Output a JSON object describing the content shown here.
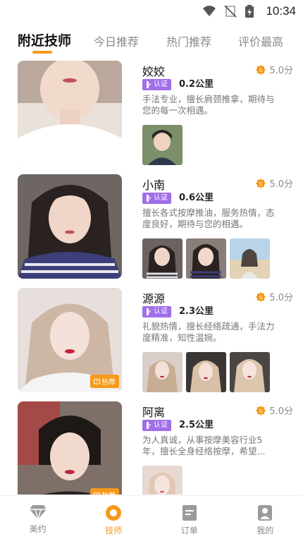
{
  "status_bar": {
    "time": "10:34"
  },
  "tabs": [
    {
      "label": "附近技师",
      "active": true
    },
    {
      "label": "今日推荐",
      "active": false
    },
    {
      "label": "热门推荐",
      "active": false
    },
    {
      "label": "评价最高",
      "active": false
    }
  ],
  "cert_label": "认证",
  "hot_label": "热荐",
  "technicians": [
    {
      "name": "姣姣",
      "rating": "5.0分",
      "distance": "0.2公里",
      "desc": "手法专业，擅长肩颈推拿，期待与您的每一次相遇。",
      "photo_count": 1,
      "hot": false
    },
    {
      "name": "小南",
      "rating": "5.0分",
      "distance": "0.6公里",
      "desc": "擅长各式按摩推油，服务热情，态度良好，期待与您的相遇。",
      "photo_count": 3,
      "hot": false
    },
    {
      "name": "源源",
      "rating": "5.0分",
      "distance": "2.3公里",
      "desc": "礼貌热情，擅长经络疏通，手法力度精准，知性温婉。",
      "photo_count": 3,
      "hot": true
    },
    {
      "name": "阿离",
      "rating": "5.0分",
      "distance": "2.5公里",
      "desc": "为人真诚，从事按摩美容行业5年，擅长全身经络按摩，希望...",
      "photo_count": 1,
      "hot": true
    }
  ],
  "bottom_nav": [
    {
      "label": "美约",
      "icon": "diamond-icon",
      "active": false
    },
    {
      "label": "技师",
      "icon": "circle-icon",
      "active": true
    },
    {
      "label": "订单",
      "icon": "document-icon",
      "active": false
    },
    {
      "label": "我的",
      "icon": "person-icon",
      "active": false
    }
  ],
  "colors": {
    "accent": "#f59a1b",
    "cert": "#a06ee8"
  }
}
